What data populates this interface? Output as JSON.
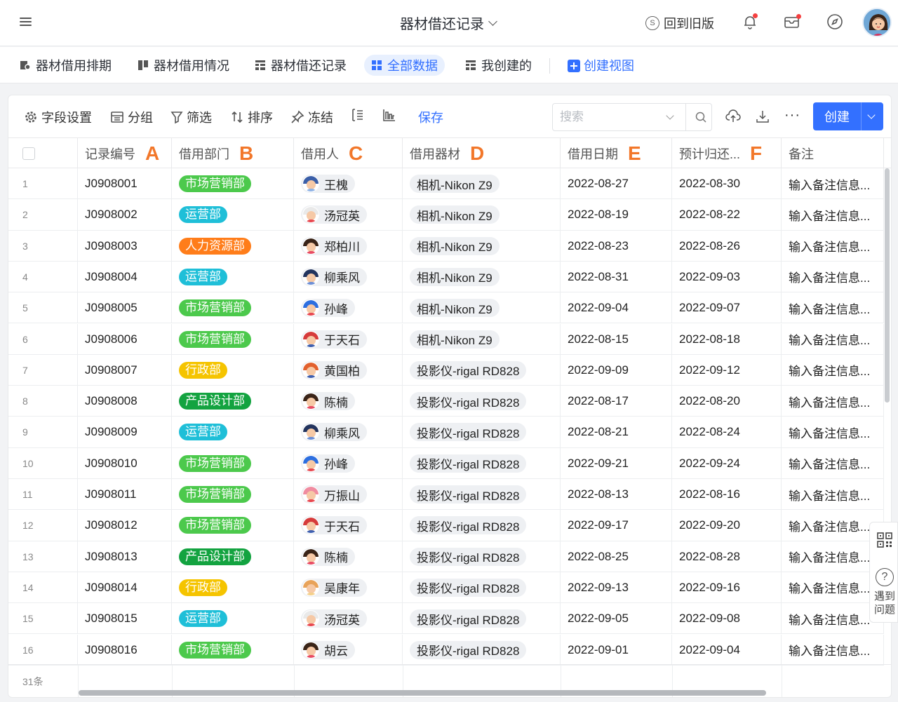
{
  "header": {
    "title": "器材借还记录",
    "old_version": "回到旧版"
  },
  "views": {
    "tabs": [
      "器材借用排期",
      "器材借用情况",
      "器材借还记录",
      "全部数据",
      "我创建的"
    ],
    "active_index": 3,
    "create_view": "创建视图"
  },
  "toolbar": {
    "fields": "字段设置",
    "group": "分组",
    "filter": "筛选",
    "sort": "排序",
    "freeze": "冻结",
    "save": "保存",
    "search_placeholder": "搜索",
    "create": "创建"
  },
  "table": {
    "columns": [
      {
        "label": "记录编号",
        "letter": "A"
      },
      {
        "label": "借用部门",
        "letter": "B"
      },
      {
        "label": "借用人",
        "letter": "C"
      },
      {
        "label": "借用器材",
        "letter": "D"
      },
      {
        "label": "借用日期",
        "letter": "E"
      },
      {
        "label": "预计归还...",
        "letter": "F"
      },
      {
        "label": "备注",
        "letter": ""
      }
    ],
    "dept_colors": {
      "市场营销部": "#4cc94c",
      "运营部": "#1fbfd8",
      "人力资源部": "#ff7d1a",
      "行政部": "#f5c400",
      "产品设计部": "#13a340"
    },
    "rows": [
      {
        "n": "1",
        "id": "J0908001",
        "dept": "市场营销部",
        "person": "王槐",
        "avatar": "blue-hair",
        "equip": "相机-Nikon Z9",
        "date": "2022-08-27",
        "ret": "2022-08-30",
        "note": "输入备注信息..."
      },
      {
        "n": "2",
        "id": "J0908002",
        "dept": "运营部",
        "person": "汤冠英",
        "avatar": "white-hair",
        "equip": "相机-Nikon Z9",
        "date": "2022-08-19",
        "ret": "2022-08-22",
        "note": "输入备注信息..."
      },
      {
        "n": "3",
        "id": "J0908003",
        "dept": "人力资源部",
        "person": "郑柏川",
        "avatar": "dark-hair",
        "equip": "相机-Nikon Z9",
        "date": "2022-08-23",
        "ret": "2022-08-26",
        "note": "输入备注信息..."
      },
      {
        "n": "4",
        "id": "J0908004",
        "dept": "运营部",
        "person": "柳乘风",
        "avatar": "navy-hair",
        "equip": "相机-Nikon Z9",
        "date": "2022-08-31",
        "ret": "2022-09-03",
        "note": "输入备注信息..."
      },
      {
        "n": "5",
        "id": "J0908005",
        "dept": "市场营销部",
        "person": "孙峰",
        "avatar": "red-cap",
        "equip": "相机-Nikon Z9",
        "date": "2022-09-04",
        "ret": "2022-09-07",
        "note": "输入备注信息..."
      },
      {
        "n": "6",
        "id": "J0908006",
        "dept": "市场营销部",
        "person": "于天石",
        "avatar": "red-hair",
        "equip": "相机-Nikon Z9",
        "date": "2022-08-15",
        "ret": "2022-08-18",
        "note": "输入备注信息..."
      },
      {
        "n": "7",
        "id": "J0908007",
        "dept": "行政部",
        "person": "黄国柏",
        "avatar": "orange-hair",
        "equip": "投影仪-rigal RD828",
        "date": "2022-09-09",
        "ret": "2022-09-12",
        "note": "输入备注信息..."
      },
      {
        "n": "8",
        "id": "J0908008",
        "dept": "产品设计部",
        "person": "陈楠",
        "avatar": "dark-hair",
        "equip": "投影仪-rigal RD828",
        "date": "2022-08-17",
        "ret": "2022-08-20",
        "note": "输入备注信息..."
      },
      {
        "n": "9",
        "id": "J0908009",
        "dept": "运营部",
        "person": "柳乘风",
        "avatar": "navy-hair",
        "equip": "投影仪-rigal RD828",
        "date": "2022-08-21",
        "ret": "2022-08-24",
        "note": "输入备注信息..."
      },
      {
        "n": "10",
        "id": "J0908010",
        "dept": "市场营销部",
        "person": "孙峰",
        "avatar": "red-cap",
        "equip": "投影仪-rigal RD828",
        "date": "2022-09-21",
        "ret": "2022-09-24",
        "note": "输入备注信息..."
      },
      {
        "n": "11",
        "id": "J0908011",
        "dept": "市场营销部",
        "person": "万振山",
        "avatar": "pink-hair",
        "equip": "投影仪-rigal RD828",
        "date": "2022-08-13",
        "ret": "2022-08-16",
        "note": "输入备注信息..."
      },
      {
        "n": "12",
        "id": "J0908012",
        "dept": "市场营销部",
        "person": "于天石",
        "avatar": "red-hair",
        "equip": "投影仪-rigal RD828",
        "date": "2022-09-17",
        "ret": "2022-09-20",
        "note": "输入备注信息..."
      },
      {
        "n": "13",
        "id": "J0908013",
        "dept": "产品设计部",
        "person": "陈楠",
        "avatar": "dark-hair",
        "equip": "投影仪-rigal RD828",
        "date": "2022-08-25",
        "ret": "2022-08-28",
        "note": "输入备注信息..."
      },
      {
        "n": "14",
        "id": "J0908014",
        "dept": "行政部",
        "person": "吴康年",
        "avatar": "tan-hair",
        "equip": "投影仪-rigal RD828",
        "date": "2022-09-13",
        "ret": "2022-09-16",
        "note": "输入备注信息..."
      },
      {
        "n": "15",
        "id": "J0908015",
        "dept": "运营部",
        "person": "汤冠英",
        "avatar": "white-hair",
        "equip": "投影仪-rigal RD828",
        "date": "2022-09-05",
        "ret": "2022-09-08",
        "note": "输入备注信息..."
      },
      {
        "n": "16",
        "id": "J0908016",
        "dept": "市场营销部",
        "person": "胡云",
        "avatar": "dark-hair",
        "equip": "投影仪-rigal RD828",
        "date": "2022-09-01",
        "ret": "2022-09-04",
        "note": "输入备注信息..."
      }
    ],
    "total": "31条"
  },
  "side_widget": {
    "help_text": "遇到问题"
  },
  "colors": {
    "accent": "#3370ff",
    "header_letter": "#f2772a"
  }
}
